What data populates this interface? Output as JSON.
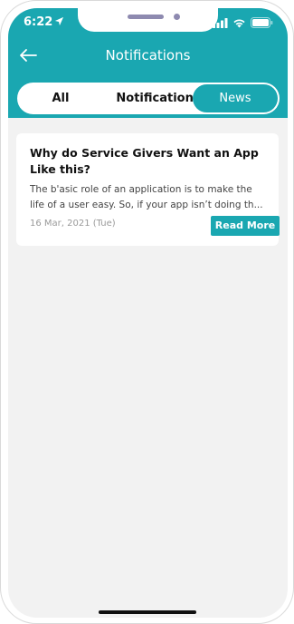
{
  "status_bar": {
    "time": "6:22",
    "icons": [
      "location-arrow-icon",
      "signal-icon",
      "wifi-icon",
      "battery-icon"
    ]
  },
  "header": {
    "title": "Notifications",
    "back_icon": "back-arrow-icon"
  },
  "tabs": [
    {
      "label": "All",
      "selected": false
    },
    {
      "label": "Notifications",
      "selected": false
    },
    {
      "label": "News",
      "selected": true
    }
  ],
  "news": [
    {
      "title": "Why do Service Givers Want an App Like this?",
      "excerpt": "The b'asic role of an application is to make the life of a user easy. So, if your app isn’t doing th...",
      "date": "16 Mar, 2021 (Tue)",
      "action_label": "Read More"
    }
  ],
  "colors": {
    "accent": "#1aa7b1",
    "background": "#f2f2f2",
    "card": "#ffffff"
  }
}
